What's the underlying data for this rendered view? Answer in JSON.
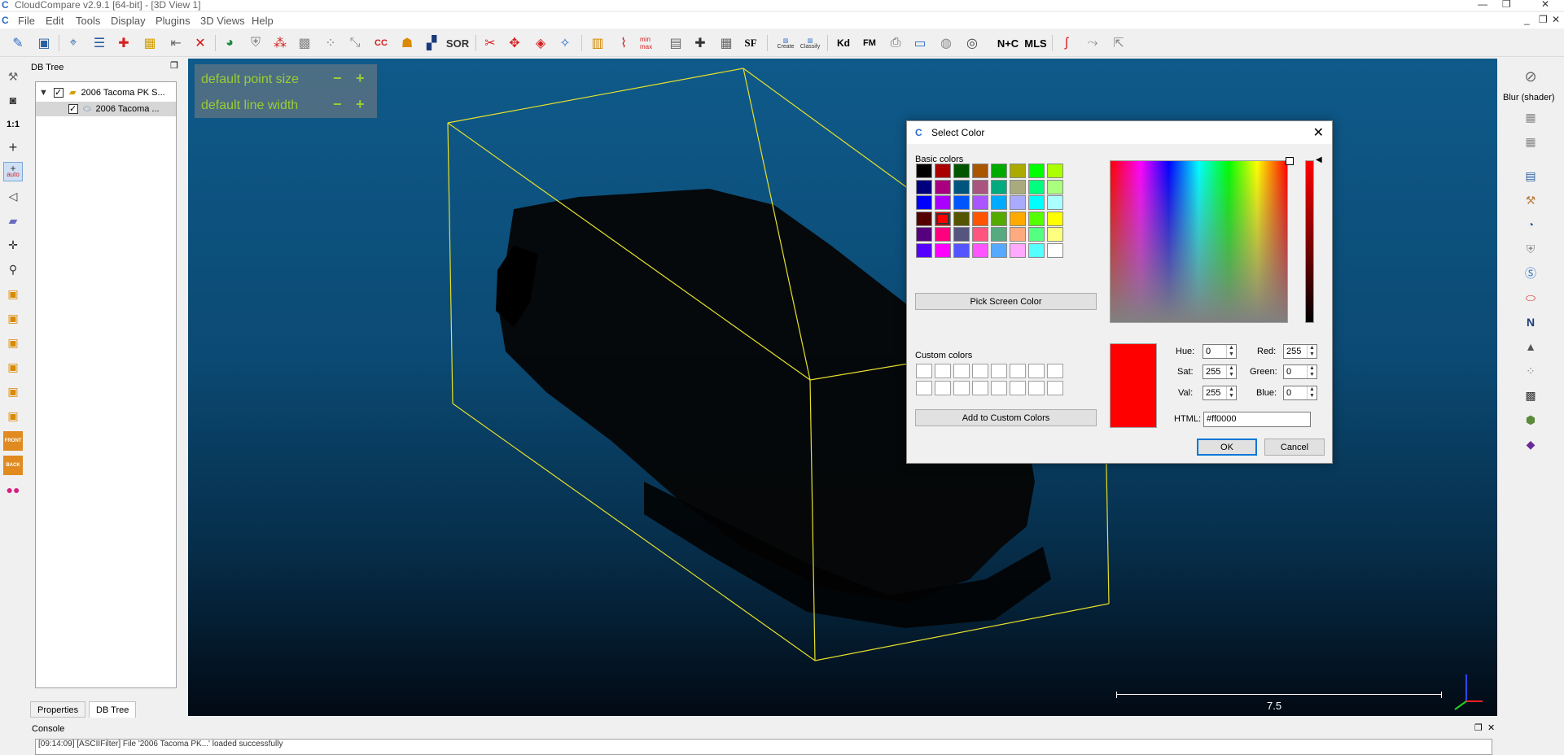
{
  "window": {
    "title": "CloudCompare v2.9.1 [64-bit] - [3D View 1]"
  },
  "menu": [
    "File",
    "Edit",
    "Tools",
    "Display",
    "Plugins",
    "3D Views",
    "Help"
  ],
  "toolbar": {
    "sor_label": "SOR",
    "sf_label": "SF",
    "canupo_create": "Create",
    "canupo_classify": "Classify",
    "kd_label": "Kd",
    "fm_label": "FM",
    "nc_label": "N+C",
    "mls_label": "MLS"
  },
  "left_toolbar": {
    "one_to_one": "1:1",
    "auto": "auto",
    "front": "FRONT",
    "back": "BACK"
  },
  "db_panel": {
    "header": "DB Tree",
    "items": [
      {
        "label": "2006 Tacoma PK S...",
        "checked": true,
        "expanded": true
      },
      {
        "label": "2006 Tacoma ...",
        "checked": true
      }
    ],
    "tabs": [
      "Properties",
      "DB Tree"
    ],
    "active_tab": "DB Tree"
  },
  "view3d": {
    "overlay": {
      "point_size_label": "default point size",
      "line_width_label": "default line width",
      "minus": "−",
      "plus": "+"
    },
    "scale_value": "7.5"
  },
  "right_panel": {
    "blur_label": "Blur (shader)",
    "n_label": "N"
  },
  "console": {
    "label": "Console",
    "text": "[09:14:09] [ASCIIFilter] File '2006 Tacoma PK...' loaded successfully"
  },
  "dialog": {
    "title": "Select Color",
    "basic_colors_label": "Basic colors",
    "basic_colors": [
      [
        "#000000",
        "#aa0000",
        "#005500",
        "#aa5500",
        "#00aa00",
        "#aaaa00",
        "#00ff00",
        "#aaff00"
      ],
      [
        "#00007f",
        "#aa007f",
        "#00557f",
        "#aa557f",
        "#00aa7f",
        "#aaaa7f",
        "#00ff7f",
        "#aaff7f"
      ],
      [
        "#0000ff",
        "#aa00ff",
        "#0055ff",
        "#aa55ff",
        "#00aaff",
        "#aaaaff",
        "#00ffff",
        "#aaffff"
      ],
      [
        "#550000",
        "#ff0000",
        "#555500",
        "#ff5500",
        "#55aa00",
        "#ffaa00",
        "#55ff00",
        "#ffff00"
      ],
      [
        "#55007f",
        "#ff007f",
        "#55557f",
        "#ff557f",
        "#55aa7f",
        "#ffaa7f",
        "#55ff7f",
        "#ffff7f"
      ],
      [
        "#5500ff",
        "#ff00ff",
        "#5555ff",
        "#ff55ff",
        "#55aaff",
        "#ffaaff",
        "#55ffff",
        "#ffffff"
      ]
    ],
    "selected_basic": [
      3,
      1
    ],
    "pick_screen_label": "Pick Screen Color",
    "custom_colors_label": "Custom colors",
    "add_custom_label": "Add to Custom Colors",
    "current_color": "#ff0000",
    "fields": {
      "hue_label": "Hue:",
      "hue": "0",
      "sat_label": "Sat:",
      "sat": "255",
      "val_label": "Val:",
      "val": "255",
      "red_label": "Red:",
      "red": "255",
      "green_label": "Green:",
      "green": "0",
      "blue_label": "Blue:",
      "blue": "0",
      "html_label": "HTML:",
      "html": "#ff0000"
    },
    "ok_label": "OK",
    "cancel_label": "Cancel"
  }
}
